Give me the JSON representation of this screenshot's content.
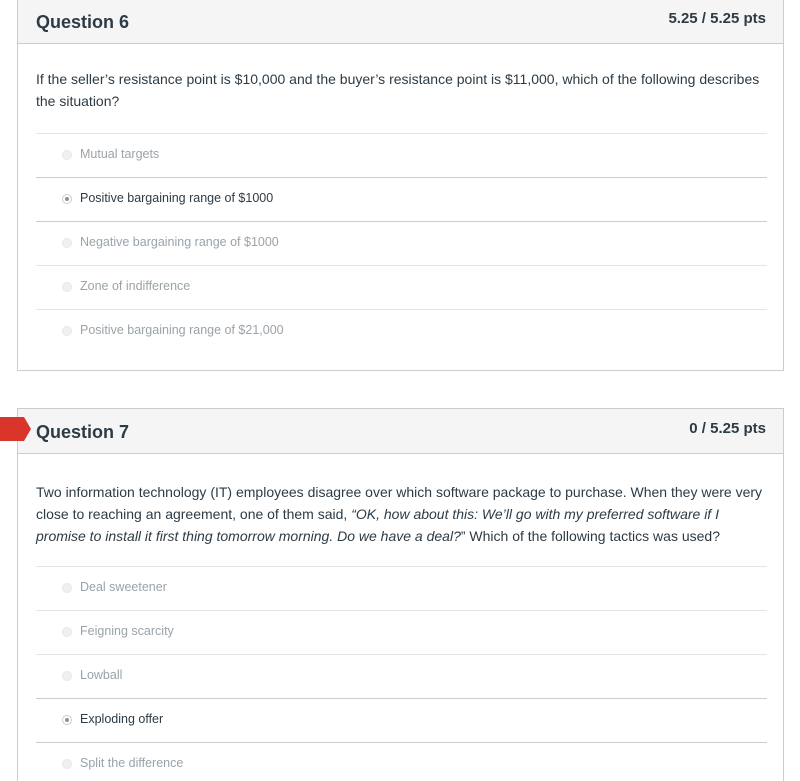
{
  "questions": [
    {
      "title": "Question 6",
      "points": "5.25 / 5.25 pts",
      "text": "If the seller’s resistance point is $10,000 and the buyer’s resistance point is $11,000, which of the following describes the situation?",
      "answers": [
        {
          "label": "Mutual targets",
          "selected": false
        },
        {
          "label": "Positive bargaining range of $1000",
          "selected": true
        },
        {
          "label": "Negative bargaining range of $1000",
          "selected": false
        },
        {
          "label": "Zone of indifference",
          "selected": false
        },
        {
          "label": "Positive bargaining range of $21,000",
          "selected": false
        }
      ]
    },
    {
      "title": "Question 7",
      "points": "0 / 5.25 pts",
      "flagged": true,
      "flag_color": "#d9352b",
      "text_before": "Two information technology (IT) employees disagree over which software package to purchase. When they were very close to reaching an agreement, one of them said, ",
      "text_quote": "“OK, how about this: We’ll go with my preferred software if I promise to install it first thing tomorrow morning. Do we have a deal?",
      "text_after": "” Which of the following tactics was used?",
      "answers": [
        {
          "label": "Deal sweetener",
          "selected": false
        },
        {
          "label": "Feigning scarcity",
          "selected": false
        },
        {
          "label": "Lowball",
          "selected": false
        },
        {
          "label": "Exploding offer",
          "selected": true
        },
        {
          "label": "Split the difference",
          "selected": false
        }
      ]
    }
  ]
}
